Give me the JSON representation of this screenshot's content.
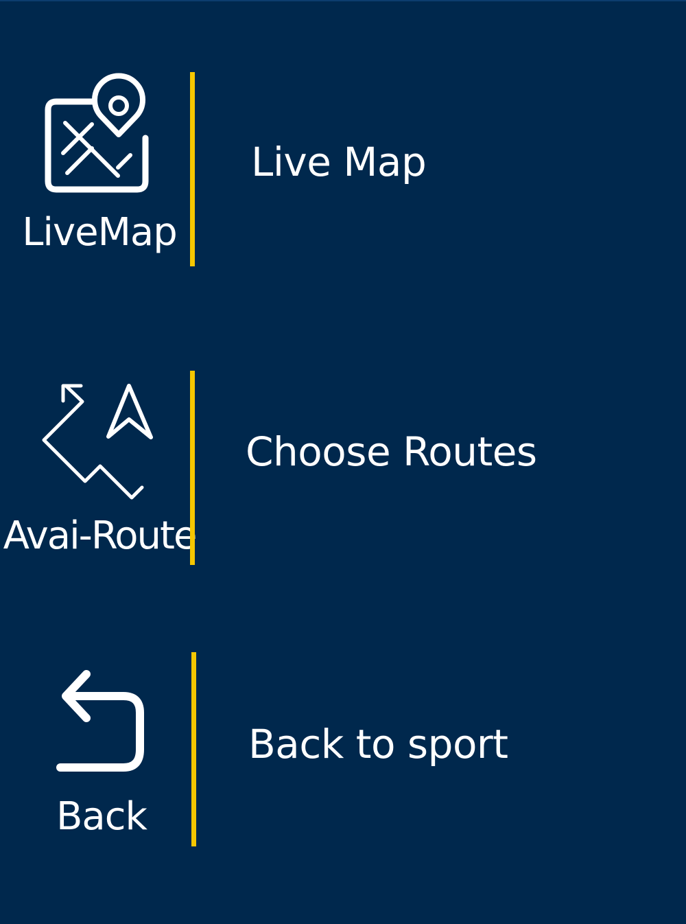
{
  "colors": {
    "background": "#00284d",
    "divider": "#f6c700",
    "text": "#ffffff"
  },
  "menu": {
    "items": [
      {
        "icon": "map-pin-icon",
        "caption": "LiveMap",
        "label": "Live Map"
      },
      {
        "icon": "route-navigation-icon",
        "caption": "Avai-Route",
        "label": "Choose Routes"
      },
      {
        "icon": "back-arrow-icon",
        "caption": "Back",
        "label": "Back to sport"
      }
    ]
  }
}
